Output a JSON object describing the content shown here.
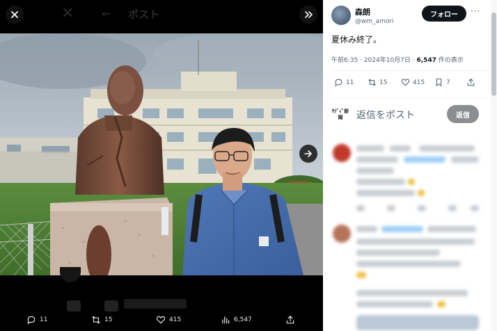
{
  "viewer": {
    "underlay_title": "ポスト",
    "stats": {
      "replies": "11",
      "retweets": "15",
      "likes": "415",
      "views": "6,547"
    }
  },
  "sidebar": {
    "author": {
      "name": "森朗",
      "handle": "@wm_amori"
    },
    "follow_label": "フォロー",
    "more_label": "···",
    "tweet_text": "夏休み終了。",
    "meta": {
      "time": "午前6:35",
      "sep": " · ",
      "date": "2024年10月7日",
      "sep2": " · ",
      "views": "6,547",
      "views_suffix": " 件の表示"
    },
    "actions": {
      "replies": "11",
      "retweets": "15",
      "likes": "415",
      "bookmarks": "7"
    },
    "compose": {
      "logo_text": "ｻﾃﾞｨﾞ新聞",
      "placeholder": "返信をポスト",
      "reply_label": "返信"
    }
  },
  "colors": {
    "accent": "#1d9bf0",
    "text_primary": "#0f1419",
    "text_secondary": "#536471",
    "follow_bg": "#0f1419",
    "reply_btn_bg": "#8b8d90"
  },
  "icons": [
    "close-icon",
    "expand-icon",
    "next-arrow-icon",
    "reply-icon",
    "retweet-icon",
    "like-icon",
    "views-icon",
    "share-icon",
    "bookmark-icon",
    "more-icon"
  ]
}
